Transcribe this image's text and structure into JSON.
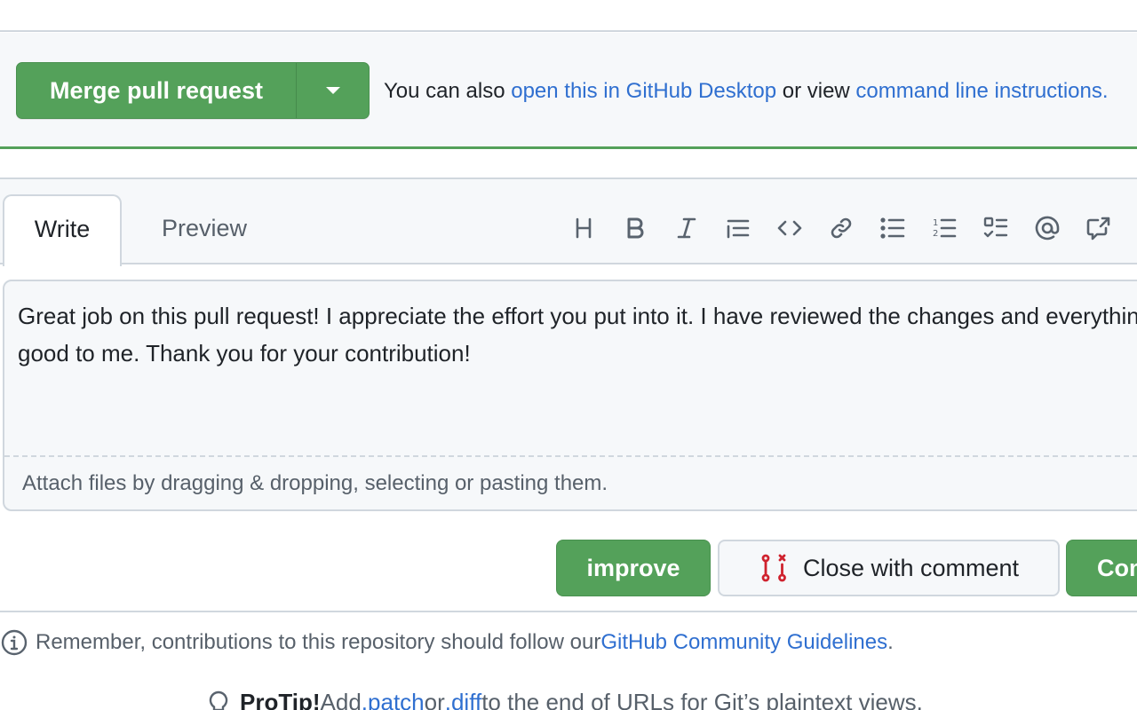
{
  "merge": {
    "button_label": "Merge pull request",
    "dropdown_icon": "triangle-down-icon",
    "note_prefix": "You can also ",
    "desktop_link": "open this in GitHub Desktop",
    "note_middle": " or view ",
    "cli_link": "command line instructions."
  },
  "editor": {
    "tabs": [
      {
        "label": "Write",
        "active": true
      },
      {
        "label": "Preview",
        "active": false
      }
    ],
    "toolbar": [
      {
        "name": "heading",
        "icon": "heading-icon"
      },
      {
        "name": "bold",
        "icon": "bold-icon"
      },
      {
        "name": "italic",
        "icon": "italic-icon"
      },
      {
        "name": "quote",
        "icon": "quote-icon"
      },
      {
        "name": "code",
        "icon": "code-icon"
      },
      {
        "name": "link",
        "icon": "link-icon"
      },
      {
        "name": "unordered-list",
        "icon": "list-unordered-icon"
      },
      {
        "name": "ordered-list",
        "icon": "list-ordered-icon"
      },
      {
        "name": "task-list",
        "icon": "tasklist-icon"
      },
      {
        "name": "mention",
        "icon": "mention-icon"
      },
      {
        "name": "reference",
        "icon": "cross-reference-icon"
      }
    ],
    "comment_value": "Great job on this pull request! I appreciate the effort you put into it. I have reviewed the changes and everything looks good to me. Thank you for your contribution!",
    "attach_text": "Attach files by dragging & dropping, selecting or pasting them."
  },
  "actions": {
    "improve_label": "improve",
    "close_label": "Close with comment",
    "close_icon": "git-pull-request-closed-icon",
    "comment_label": "Comment",
    "close_icon_color": "#cf222e",
    "primary_color": "#54a15a"
  },
  "footer": {
    "guidelines_prefix": "Remember, contributions to this repository should follow our ",
    "guidelines_link": "GitHub Community Guidelines",
    "guidelines_suffix": ".",
    "protip_bold": "ProTip!",
    "protip_text1": " Add ",
    "protip_patch": ".patch",
    "protip_text2": " or ",
    "protip_diff": ".diff",
    "protip_text3": " to the end of URLs for Git’s plaintext views."
  }
}
